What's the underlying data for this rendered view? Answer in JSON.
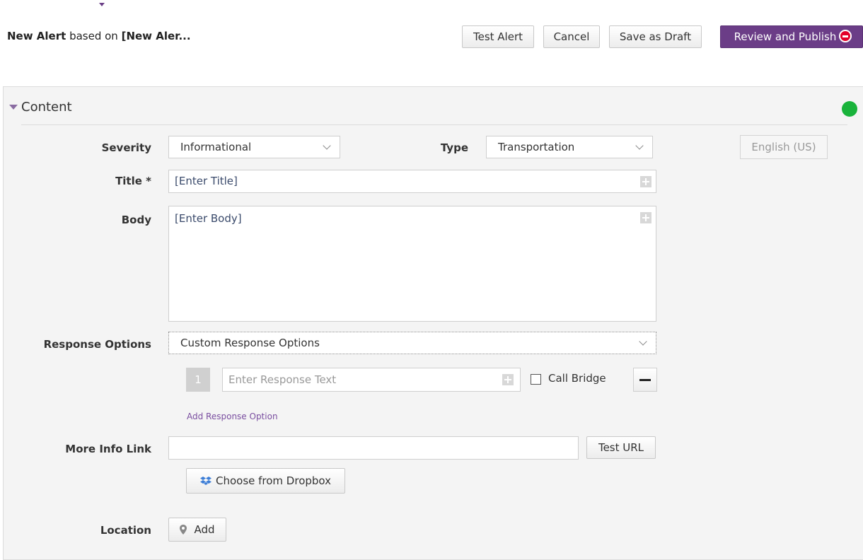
{
  "header": {
    "title_bold": "New Alert",
    "title_mid": " based on ",
    "title_ref": "[New Aler...",
    "test_alert_label": "Test Alert",
    "cancel_label": "Cancel",
    "save_draft_label": "Save as Draft",
    "review_publish_label": "Review and Publish"
  },
  "section": {
    "title": "Content",
    "status_color": "#19b33b"
  },
  "form": {
    "severity_label": "Severity",
    "severity_value": "Informational",
    "type_label": "Type",
    "type_value": "Transportation",
    "language_label": "English (US)",
    "title_label": "Title *",
    "title_value": "[Enter Title]",
    "body_label": "Body",
    "body_value": "[Enter Body]",
    "response_options_label": "Response Options",
    "response_options_value": "Custom Response Options",
    "response_number": "1",
    "response_placeholder": "Enter Response Text",
    "call_bridge_label": "Call Bridge",
    "add_response_label": "Add Response Option",
    "more_info_label": "More Info Link",
    "more_info_value": "",
    "test_url_label": "Test URL",
    "dropbox_label": "Choose from Dropbox",
    "location_label": "Location",
    "location_add_label": "Add"
  },
  "colors": {
    "accent": "#6b3d87",
    "panel_bg": "#f4f4f4",
    "stop_icon": "#e3002a",
    "link": "#7a4ea0"
  }
}
